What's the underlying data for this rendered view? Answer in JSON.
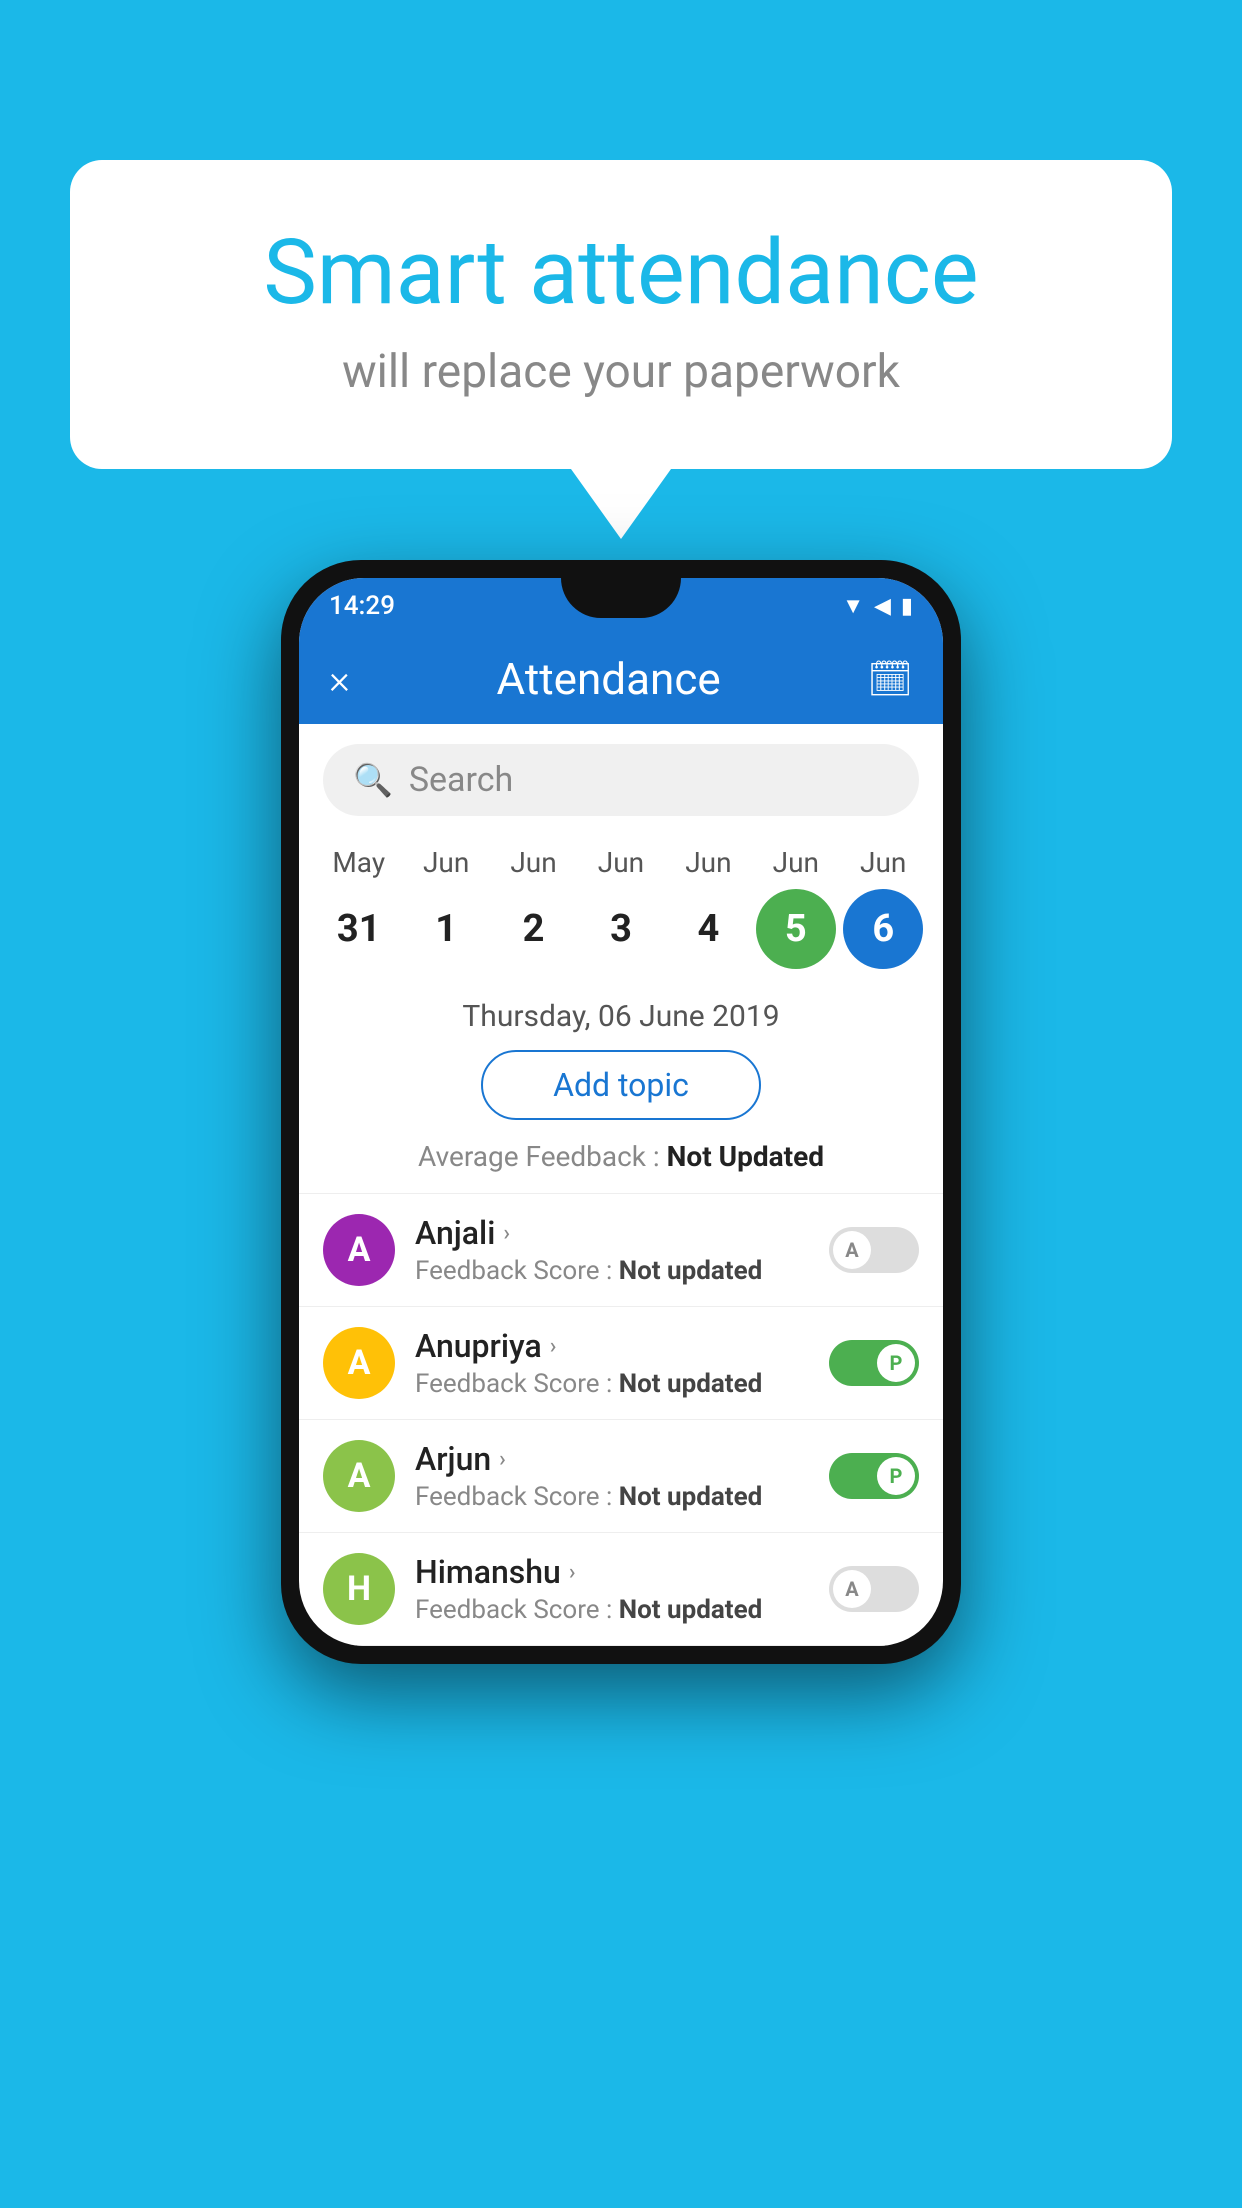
{
  "background_color": "#1bb8e8",
  "speech_bubble": {
    "title": "Smart attendance",
    "subtitle": "will replace your paperwork"
  },
  "status_bar": {
    "time": "14:29",
    "icons": [
      "▼",
      "◀",
      "▮"
    ]
  },
  "app_bar": {
    "title": "Attendance",
    "close_label": "×",
    "calendar_icon": "📅"
  },
  "search": {
    "placeholder": "Search"
  },
  "calendar": {
    "months": [
      "May",
      "Jun",
      "Jun",
      "Jun",
      "Jun",
      "Jun",
      "Jun"
    ],
    "days": [
      "31",
      "1",
      "2",
      "3",
      "4",
      "5",
      "6"
    ],
    "selected_green": 5,
    "selected_blue": 6
  },
  "date_label": "Thursday, 06 June 2019",
  "add_topic_label": "Add topic",
  "avg_feedback_label": "Average Feedback :",
  "avg_feedback_value": "Not Updated",
  "students": [
    {
      "name": "Anjali",
      "avatar_letter": "A",
      "avatar_color": "#9c27b0",
      "feedback_label": "Feedback Score :",
      "feedback_value": "Not updated",
      "toggle": "off",
      "toggle_letter": "A"
    },
    {
      "name": "Anupriya",
      "avatar_letter": "A",
      "avatar_color": "#ffc107",
      "feedback_label": "Feedback Score :",
      "feedback_value": "Not updated",
      "toggle": "on",
      "toggle_letter": "P"
    },
    {
      "name": "Arjun",
      "avatar_letter": "A",
      "avatar_color": "#8bc34a",
      "feedback_label": "Feedback Score :",
      "feedback_value": "Not updated",
      "toggle": "on",
      "toggle_letter": "P"
    },
    {
      "name": "Himanshu",
      "avatar_letter": "H",
      "avatar_color": "#8bc34a",
      "feedback_label": "Feedback Score :",
      "feedback_value": "Not updated",
      "toggle": "off",
      "toggle_letter": "A"
    }
  ]
}
